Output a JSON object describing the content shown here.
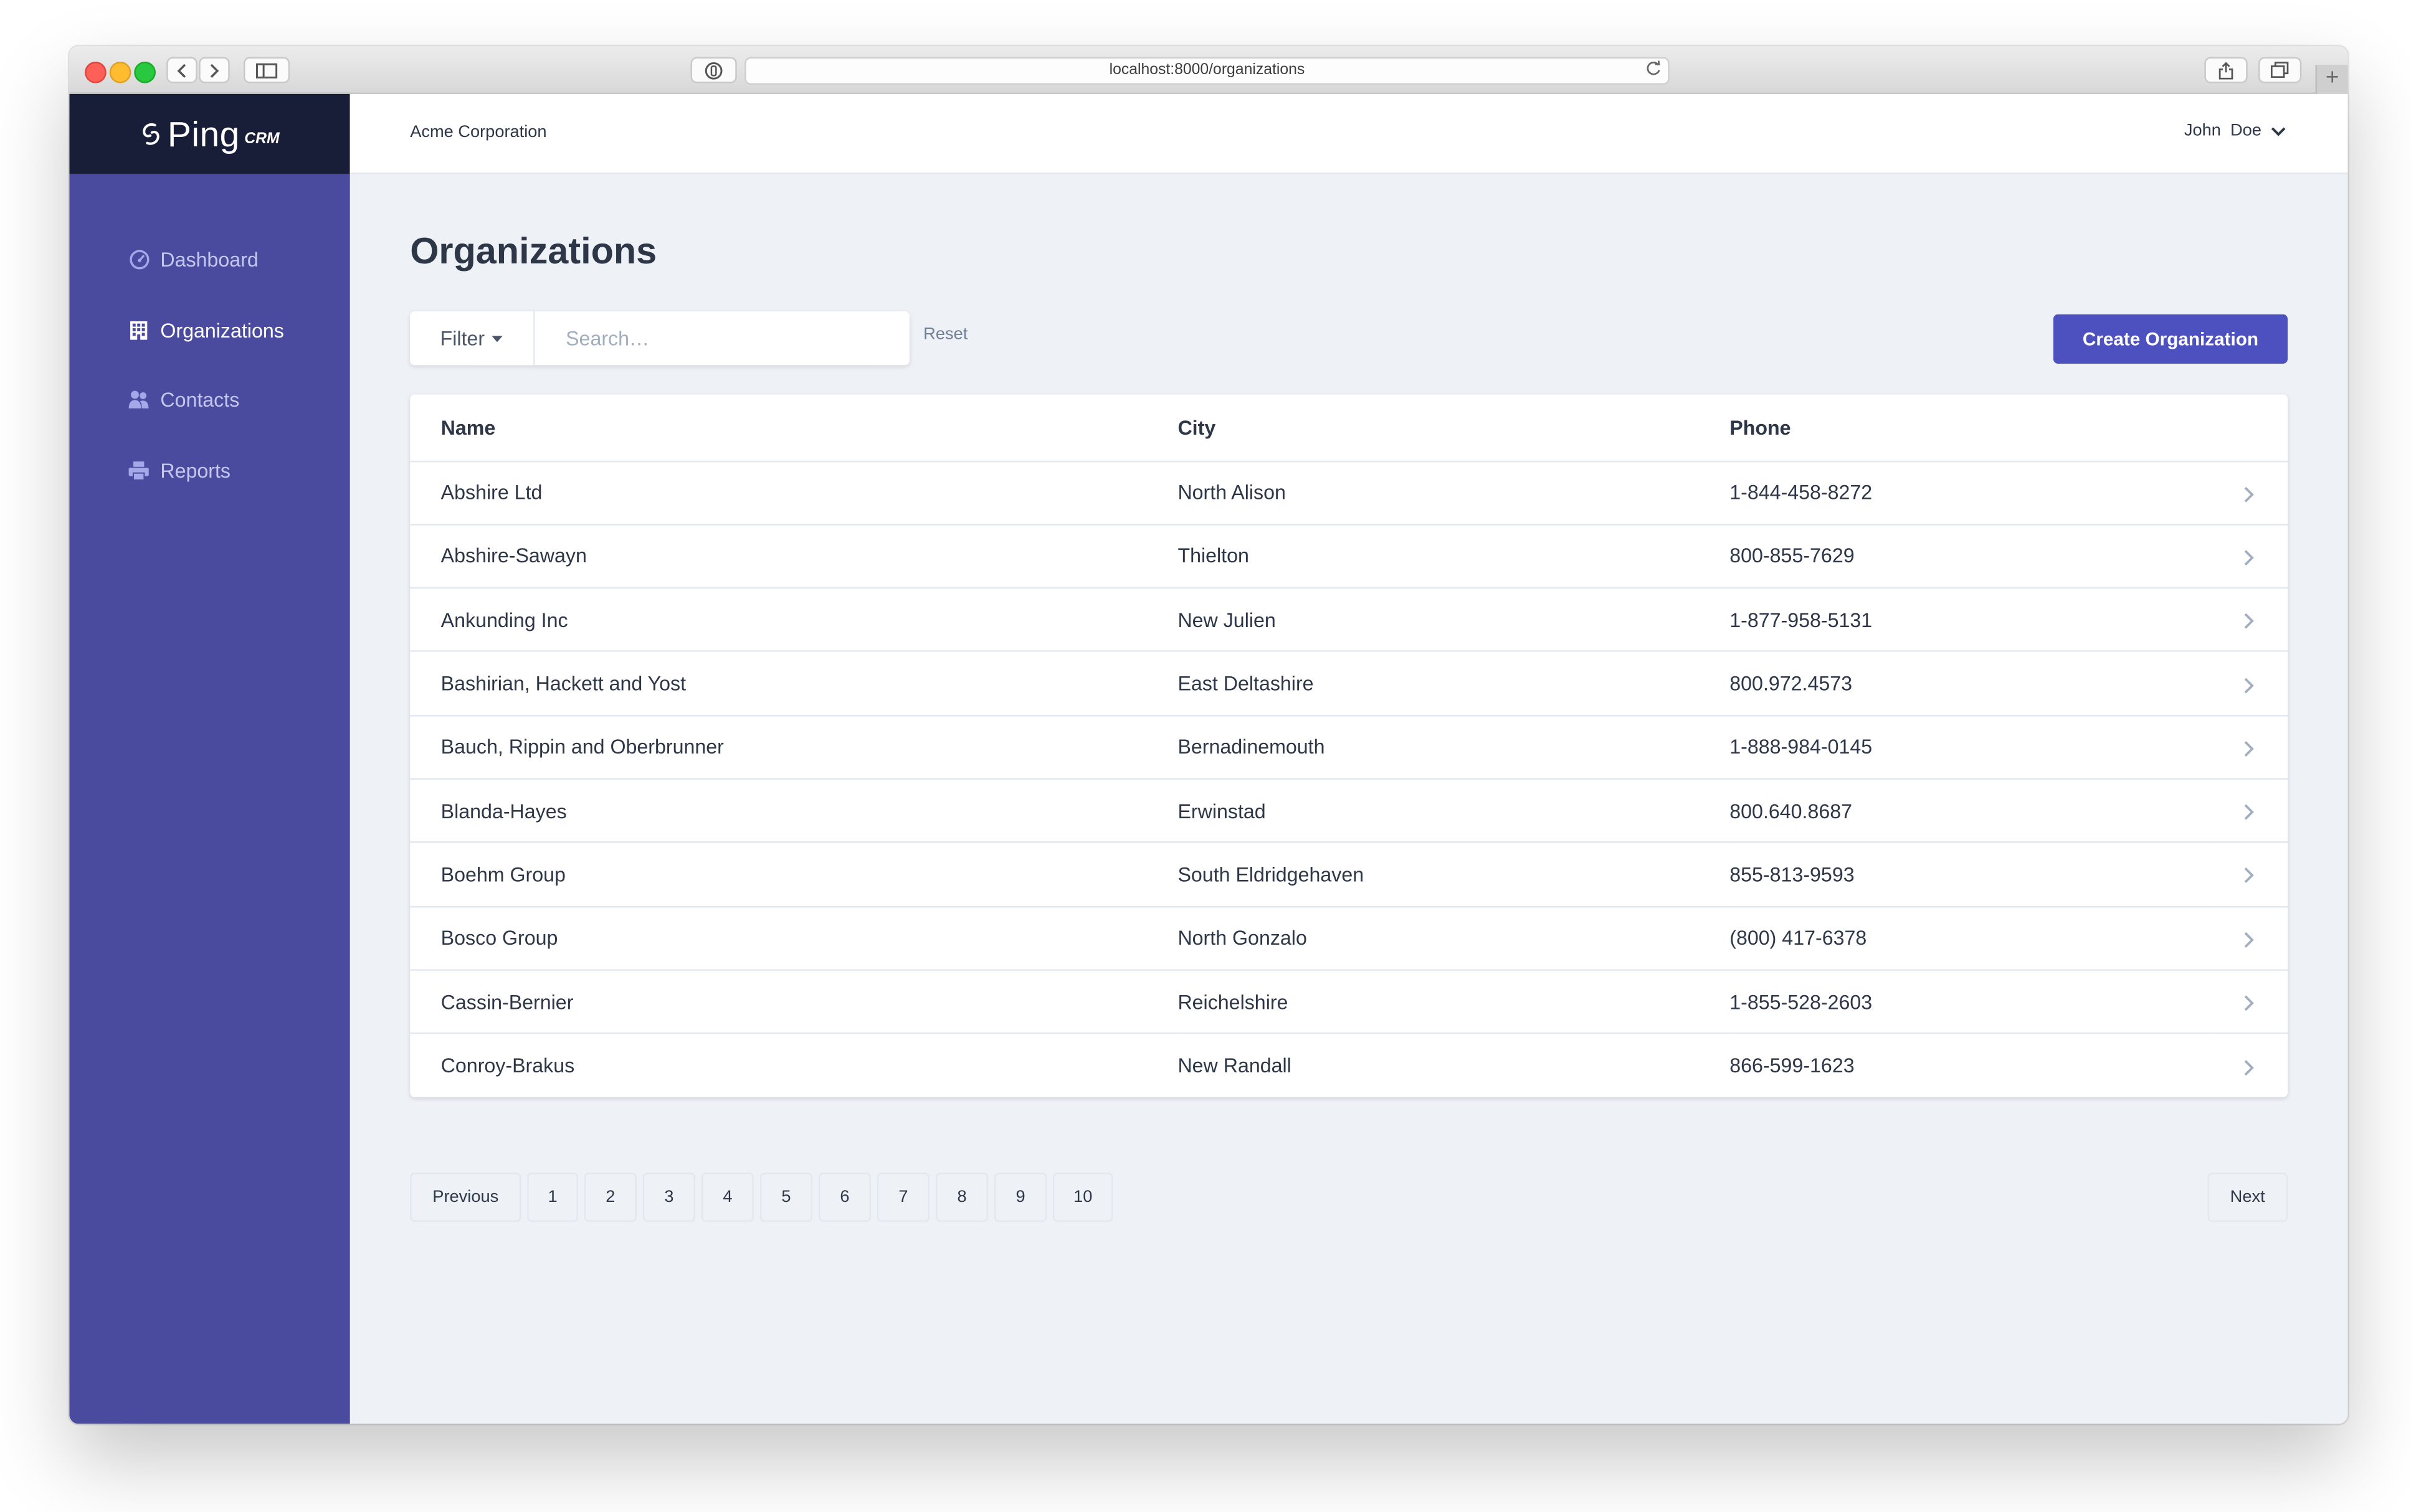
{
  "browser": {
    "url": "localhost:8000/organizations"
  },
  "app": {
    "brand_name": "Ping",
    "brand_suffix": "CRM"
  },
  "sidebar": {
    "items": [
      {
        "label": "Dashboard",
        "icon": "dashboard-icon",
        "active": false
      },
      {
        "label": "Organizations",
        "icon": "building-icon",
        "active": true
      },
      {
        "label": "Contacts",
        "icon": "users-icon",
        "active": false
      },
      {
        "label": "Reports",
        "icon": "printer-icon",
        "active": false
      }
    ]
  },
  "header": {
    "account_name": "Acme Corporation",
    "user_name": "John  Doe"
  },
  "main": {
    "title": "Organizations",
    "filter_label": "Filter",
    "search_placeholder": "Search…",
    "search_value": "",
    "reset_label": "Reset",
    "create_label": "Create Organization"
  },
  "table": {
    "columns": [
      "Name",
      "City",
      "Phone"
    ],
    "rows": [
      {
        "name": "Abshire Ltd",
        "city": "North Alison",
        "phone": "1-844-458-8272"
      },
      {
        "name": "Abshire-Sawayn",
        "city": "Thielton",
        "phone": "800-855-7629"
      },
      {
        "name": "Ankunding Inc",
        "city": "New Julien",
        "phone": "1-877-958-5131"
      },
      {
        "name": "Bashirian, Hackett and Yost",
        "city": "East Deltashire",
        "phone": "800.972.4573"
      },
      {
        "name": "Bauch, Rippin and Oberbrunner",
        "city": "Bernadinemouth",
        "phone": "1-888-984-0145"
      },
      {
        "name": "Blanda-Hayes",
        "city": "Erwinstad",
        "phone": "800.640.8687"
      },
      {
        "name": "Boehm Group",
        "city": "South Eldridgehaven",
        "phone": "855-813-9593"
      },
      {
        "name": "Bosco Group",
        "city": "North Gonzalo",
        "phone": "(800) 417-6378"
      },
      {
        "name": "Cassin-Bernier",
        "city": "Reichelshire",
        "phone": "1-855-528-2603"
      },
      {
        "name": "Conroy-Brakus",
        "city": "New Randall",
        "phone": "866-599-1623"
      }
    ]
  },
  "pagination": {
    "previous": "Previous",
    "pages": [
      "1",
      "2",
      "3",
      "4",
      "5",
      "6",
      "7",
      "8",
      "9",
      "10"
    ],
    "next": "Next"
  },
  "colors": {
    "sidebar": "#4a4a9e",
    "brand_bar": "#191e38",
    "accent": "#4c51bf",
    "content_bg": "#eef2f7"
  }
}
